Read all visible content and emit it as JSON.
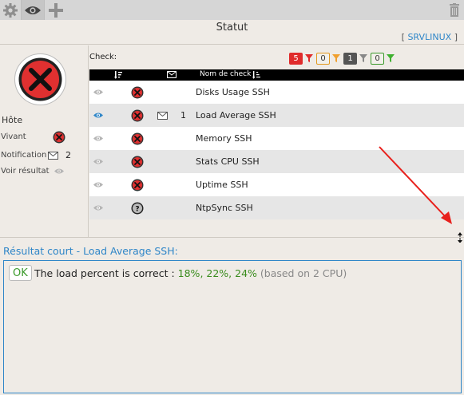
{
  "toolbar": {
    "settings_icon": "gear-icon",
    "view_icon": "eye-icon",
    "add_icon": "plus-icon",
    "delete_icon": "trash-icon"
  },
  "header": {
    "title": "Statut",
    "host_prefix": "[ ",
    "host_name": "SRVLINUX",
    "host_suffix": " ]"
  },
  "host": {
    "status_icon": "critical-x-icon",
    "section_title": "Hôte",
    "rows": [
      {
        "label": "Vivant",
        "icon": "critical-x-icon"
      },
      {
        "label": "Notification",
        "icon": "mail-icon",
        "value": "2"
      },
      {
        "label": "Voir résultat",
        "icon": "eye-icon"
      }
    ]
  },
  "checks": {
    "label": "Check:",
    "filters": [
      {
        "count": "5",
        "bg": "#e02b2b",
        "fg": "#ffffff",
        "border": "#e02b2b",
        "funnel": "#e02b2b"
      },
      {
        "count": "0",
        "bg": "#f2f0ea",
        "fg": "#333333",
        "border": "#e39a1f",
        "funnel": "#f0a030"
      },
      {
        "count": "1",
        "bg": "#555555",
        "fg": "#ffffff",
        "border": "#555555",
        "funnel": "#888888"
      },
      {
        "count": "0",
        "bg": "#f2f0ea",
        "fg": "#333333",
        "border": "#3a9a2a",
        "funnel": "#3fb030"
      }
    ],
    "columns": {
      "sort_icon": "sort-desc-icon",
      "mail_icon": "mail-icon",
      "name": "Nom de check",
      "name_sort_icon": "sort-alpha-icon"
    },
    "rows": [
      {
        "name": "Disks Usage SSH",
        "status": "critical",
        "selected": false,
        "mail": false,
        "notif": ""
      },
      {
        "name": "Load Average SSH",
        "status": "critical",
        "selected": true,
        "mail": true,
        "notif": "1"
      },
      {
        "name": "Memory SSH",
        "status": "critical",
        "selected": false,
        "mail": false,
        "notif": ""
      },
      {
        "name": "Stats CPU SSH",
        "status": "critical",
        "selected": false,
        "mail": false,
        "notif": ""
      },
      {
        "name": "Uptime SSH",
        "status": "critical",
        "selected": false,
        "mail": false,
        "notif": ""
      },
      {
        "name": "NtpSync SSH",
        "status": "unknown",
        "selected": false,
        "mail": false,
        "notif": ""
      }
    ]
  },
  "result": {
    "title": "Résultat court - Load Average SSH:",
    "state": "OK",
    "text": "The load percent is correct : ",
    "values": "18%, 22%, 24%",
    "note": " (based on 2 CPU)"
  },
  "colors": {
    "accent": "#2f86c8",
    "critical": "#e03030",
    "ok": "#3a9a2a"
  }
}
